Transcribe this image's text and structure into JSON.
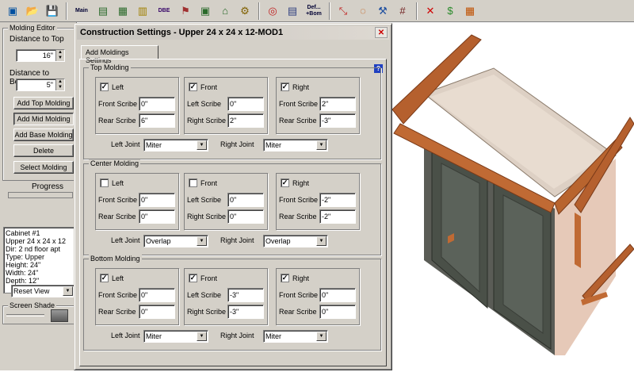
{
  "toolbar": {
    "buttons": [
      {
        "icon": "window-icon",
        "glyph": "▣"
      },
      {
        "icon": "open-folder-icon",
        "glyph": "📂"
      },
      {
        "icon": "save-icon",
        "glyph": "💾"
      },
      {
        "icon": "main-icon",
        "text": "Main"
      },
      {
        "icon": "cabinet-icon",
        "glyph": "▤"
      },
      {
        "icon": "cabinet-grid-icon",
        "glyph": "▦"
      },
      {
        "icon": "drawer-icon",
        "glyph": "▥"
      },
      {
        "icon": "dbe-icon",
        "text": "DBE"
      },
      {
        "icon": "chair-icon",
        "glyph": "⚑"
      },
      {
        "icon": "frame-icon",
        "glyph": "▣"
      },
      {
        "icon": "molding-icon",
        "glyph": "⌂"
      },
      {
        "icon": "hardware-icon",
        "glyph": "⚙"
      },
      {
        "icon": "target-icon",
        "glyph": "◎"
      },
      {
        "icon": "form-icon",
        "glyph": "▤"
      },
      {
        "icon": "defaults-icon",
        "text": "Def...\n+Bom"
      },
      {
        "icon": "measure-icon",
        "glyph": "⤡"
      },
      {
        "icon": "ring-icon",
        "glyph": "◌"
      },
      {
        "icon": "tools-icon",
        "glyph": "⚒"
      },
      {
        "icon": "grid-icon",
        "glyph": "#"
      },
      {
        "icon": "delete-icon",
        "glyph": "✕"
      },
      {
        "icon": "money-icon",
        "glyph": "$"
      },
      {
        "icon": "calendar-icon",
        "glyph": "▦"
      }
    ]
  },
  "left_panel": {
    "molding_editor_title": "Molding Editor",
    "distance_to_top_label": "Distance to Top",
    "distance_to_top_value": "16\"",
    "distance_to_bottom_label": "Distance to Bottom",
    "distance_to_bottom_value": "5\"",
    "add_top_label": "Add Top Molding",
    "add_mid_label": "Add Mid Molding",
    "add_base_label": "Add Base Molding",
    "delete_label": "Delete",
    "select_label": "Select Molding",
    "progress_label": "Progress",
    "info_lines": [
      "Cabinet #1",
      "Upper 24 x 24 x 12",
      "Dir: 2 nd floor apt",
      "Type: Upper",
      "Height: 24\"",
      "Width: 24\"",
      "Depth: 12\""
    ],
    "reset_view": "Reset View",
    "screen_shade_label": "Screen Shade"
  },
  "dialog": {
    "title": "Construction Settings - Upper 24 x 24 x 12-MOD1",
    "close_glyph": "✕",
    "tab_label": "Add Moldings Settings",
    "help_glyph": "?",
    "top": {
      "legend": "Top Molding",
      "left": {
        "label": "Left",
        "checked": true,
        "scribe1_label": "Front Scribe",
        "scribe1": "0\"",
        "scribe2_label": "Rear Scribe",
        "scribe2": "6\""
      },
      "front": {
        "label": "Front",
        "checked": true,
        "scribe1_label": "Left Scribe",
        "scribe1": "0\"",
        "scribe2_label": "Right Scribe",
        "scribe2": "2\""
      },
      "right": {
        "label": "Right",
        "checked": true,
        "scribe1_label": "Front Scribe",
        "scribe1": "2\"",
        "scribe2_label": "Rear Scribe",
        "scribe2": "-3\""
      },
      "left_joint_label": "Left Joint",
      "left_joint": "Miter",
      "right_joint_label": "Right Joint",
      "right_joint": "Miter"
    },
    "center": {
      "legend": "Center Molding",
      "left": {
        "label": "Left",
        "checked": false,
        "scribe1_label": "Front Scribe",
        "scribe1": "0\"",
        "scribe2_label": "Rear Scribe",
        "scribe2": "0\""
      },
      "front": {
        "label": "Front",
        "checked": false,
        "scribe1_label": "Left Scribe",
        "scribe1": "0\"",
        "scribe2_label": "Right Scribe",
        "scribe2": "0\""
      },
      "right": {
        "label": "Right",
        "checked": true,
        "scribe1_label": "Front Scribe",
        "scribe1": "-2\"",
        "scribe2_label": "Rear Scribe",
        "scribe2": "-2\""
      },
      "left_joint_label": "Left Joint",
      "left_joint": "Overlap",
      "right_joint_label": "Right Joint",
      "right_joint": "Overlap"
    },
    "bottom": {
      "legend": "Bottom Molding",
      "left": {
        "label": "Left",
        "checked": true,
        "scribe1_label": "Front Scribe",
        "scribe1": "0\"",
        "scribe2_label": "Rear Scribe",
        "scribe2": "0\""
      },
      "front": {
        "label": "Front",
        "checked": true,
        "scribe1_label": "Left Scribe",
        "scribe1": "-3\"",
        "scribe2_label": "Right Scribe",
        "scribe2": "-3\""
      },
      "right": {
        "label": "Right",
        "checked": true,
        "scribe1_label": "Front Scribe",
        "scribe1": "0\"",
        "scribe2_label": "Rear Scribe",
        "scribe2": "0\""
      },
      "left_joint_label": "Left Joint",
      "left_joint": "Miter",
      "right_joint_label": "Right Joint",
      "right_joint": "Miter"
    }
  },
  "colors": {
    "molding": "#b5602e",
    "cabinet_side": "#e6c9b8",
    "cabinet_top": "#d8c8b8",
    "door": "#4a5048"
  }
}
